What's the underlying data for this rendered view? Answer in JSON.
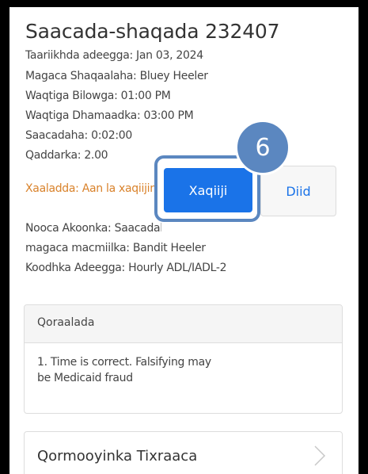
{
  "visit": {
    "title": "Saacada-shaqada 232407",
    "service_date": "Taariikhda adeegga: Jan 03, 2024",
    "worker_name": "Magaca Shaqaalaha: Bluey Heeler",
    "start_time": "Waqtiga Bilowga: 01:00 PM",
    "end_time": "Waqtiga Dhamaadka: 03:00 PM",
    "hours": "Saacadaha: 0:02:00",
    "amount": "Qaddarka: 2.00",
    "status": "Xaaladda: Aan la xaqiijin",
    "account_type": "Nooca Akoonka: Saacadaha",
    "client_name": "magaca macmiilka: Bandit Heeler",
    "service_code": "Koodhka Adeegga: Hourly ADL/IADL-2"
  },
  "actions": {
    "verify_label": "Xaqiiji",
    "decline_label": "Diid"
  },
  "callout": {
    "step_number": "6"
  },
  "notes": {
    "header": "Qoraalada",
    "text": "1. Time is correct. Falsifying may be Medicaid fraud"
  },
  "tasks": {
    "label": "Qormooyinka Tixraaca"
  },
  "colors": {
    "accent": "#1a73e8",
    "status": "#d9822b",
    "callout": "#5b87c0"
  }
}
